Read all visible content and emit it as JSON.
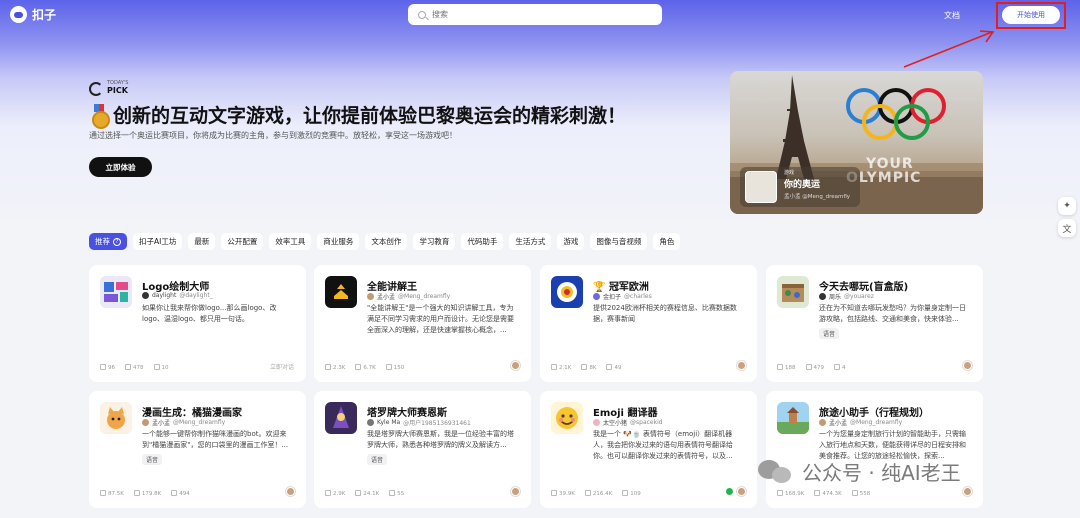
{
  "app": {
    "name": "扣子"
  },
  "header": {
    "search_placeholder": "搜索",
    "docs_label": "文档",
    "start_label": "开始使用"
  },
  "hero": {
    "pick_small": "TODAY'S",
    "pick_big": "PICK",
    "title": "创新的互动文字游戏，让你提前体验巴黎奥运会的精彩刺激！",
    "subtitle": "通过选择一个奥运比赛项目，你将成为比赛的主角，参与到激烈的竞赛中。放轻松，享受这一场游戏吧！",
    "cta_label": "立即体验",
    "banner": {
      "brand_line1": "YOUR",
      "brand_line2": "OLYMPIC",
      "tag": "游戏",
      "name": "你的奥运",
      "author": "孟小孟 @Meng_dreamfly",
      "ring_colors": [
        "#2a7fd4",
        "#111111",
        "#e0202e",
        "#f2b51f",
        "#1f9c45"
      ]
    }
  },
  "categories": [
    "推荐",
    "扣子AI工坊",
    "最新",
    "公开配置",
    "效率工具",
    "商业服务",
    "文本创作",
    "学习教育",
    "代码助手",
    "生活方式",
    "游戏",
    "图像与音视频",
    "角色"
  ],
  "cards": [
    {
      "title": "Logo绘制大师",
      "author": "daylight",
      "handle": "@daylight_",
      "desc": "如果你让我来帮你做logo...那么画logo、改logo、温湿logo、都只用一句话。",
      "tag": "",
      "stats": [
        "96",
        "478",
        "10"
      ],
      "action": "立即对话"
    },
    {
      "title": "全能讲解王",
      "author": "孟小孟",
      "handle": "@Meng_dreamfly",
      "desc": "\"全能讲解王\"是一个强大的知识讲解工具，专为满足不同学习需求的用户而设计。无论您是需要全面深入的理解，还是快速掌握核心概念，...",
      "tag": "",
      "stats": [
        "2.3K",
        "6.7K",
        "150"
      ],
      "action": ""
    },
    {
      "title": "冠军欧洲",
      "author": "金扣子",
      "handle": "@charles",
      "desc": "提供2024欧洲杯相关的赛程信息、比赛数据数据，赛事新闻",
      "tag": "",
      "stats": [
        "2.1K",
        "8K",
        "49"
      ],
      "action": ""
    },
    {
      "title": "今天去哪玩(盲盒版)",
      "author": "周乐",
      "handle": "@youarez",
      "desc": "还在为不知道去哪玩发愁吗？为你量身定制一日游攻略，包括路线、交通和美食，快来体验...",
      "tag": "语音",
      "stats": [
        "188",
        "479",
        "4"
      ],
      "action": ""
    },
    {
      "title": "漫画生成：橘猫漫画家",
      "author": "孟小孟",
      "handle": "@Meng_dreamfly",
      "desc": "一个能够一键帮你制作猫咪漫画的bot。欢迎来到\"橘猫漫画家\"，您的口袋里的漫画工作室！...",
      "tag": "语音",
      "stats": [
        "87.5K",
        "179.8K",
        "494"
      ],
      "action": ""
    },
    {
      "title": "塔罗牌大师赛恩斯",
      "author": "Kyle Ma",
      "handle": "@用户1985136931461",
      "desc": "我是塔罗牌大师赛恩斯，我是一位经验丰富的塔罗牌大师，熟悉各种塔罗牌的牌义及解读方...",
      "tag": "语音",
      "stats": [
        "2.9K",
        "24.1K",
        "55"
      ],
      "action": ""
    },
    {
      "title": "Emoji 翻译器",
      "author": "太空小猪",
      "handle": "@spacekid",
      "desc": "我是一个 🐶🍵 表情符号（emoji）翻译机器人，我会把你发过来的语句用表情符号翻译给你。也可以翻译你发过来的表情符号，以及...",
      "tag": "",
      "stats": [
        "39.9K",
        "216.4K",
        "109"
      ],
      "action": ""
    },
    {
      "title": "旅途小助手（行程规划）",
      "author": "孟小孟",
      "handle": "@Meng_dreamfly",
      "desc": "一个为您量身定制旅行计划的智能助手，只需输入旅行地点和天数，便能获得详尽的日程安排和美食推荐。让您的旅途轻松愉快，探索...",
      "tag": "",
      "stats": [
        "168.9K",
        "474.3K",
        "558"
      ],
      "action": ""
    }
  ],
  "watermark": {
    "text": "公众号 · 纯AI老王"
  }
}
